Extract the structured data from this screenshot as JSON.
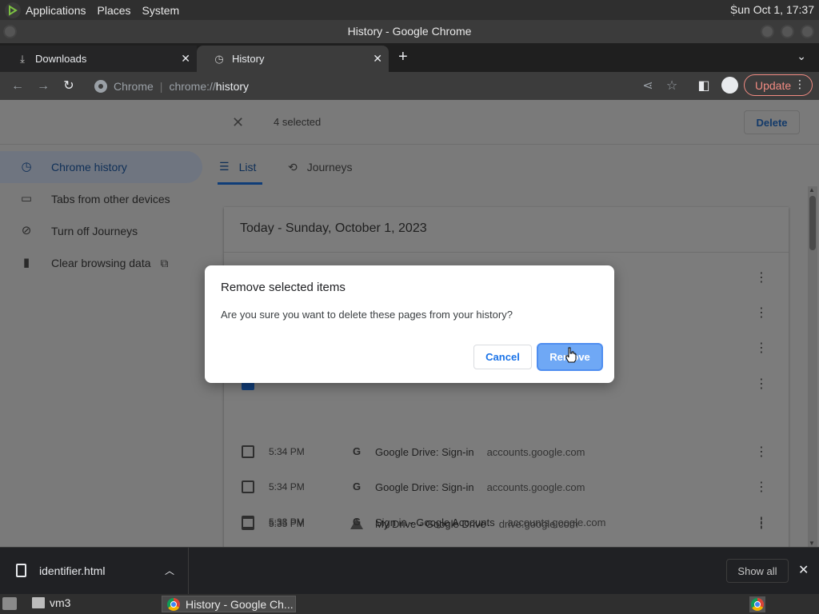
{
  "desktop": {
    "menu": [
      "Applications",
      "Places",
      "System"
    ],
    "clock": "Sun Oct  1, 17:37"
  },
  "window": {
    "title": "History - Google Chrome"
  },
  "tabs": [
    {
      "label": "Downloads",
      "icon": "download-icon"
    },
    {
      "label": "History",
      "icon": "history-clock-icon"
    }
  ],
  "toolbar": {
    "scheme": "Chrome",
    "url_host": "chrome://",
    "url_path": "history",
    "update_label": "Update"
  },
  "selection": {
    "count_label": "4 selected",
    "delete_label": "Delete"
  },
  "sidebar": {
    "items": [
      {
        "label": "Chrome history",
        "icon": "clock-icon"
      },
      {
        "label": "Tabs from other devices",
        "icon": "devices-icon"
      },
      {
        "label": "Turn off Journeys",
        "icon": "journeys-off-icon"
      },
      {
        "label": "Clear browsing data",
        "icon": "trash-icon"
      }
    ]
  },
  "view_tabs": [
    {
      "label": "List"
    },
    {
      "label": "Journeys"
    }
  ],
  "history": {
    "date_header": "Today - Sunday, October 1, 2023",
    "rows": [
      {
        "time": "5:35 PM",
        "title": "My Drive - Google Drive",
        "domain": "drive.google.com",
        "checked": false
      },
      {
        "time": "5:34 PM",
        "title": "Google Drive: Sign-in",
        "domain": "accounts.google.com",
        "checked": false
      },
      {
        "time": "5:34 PM",
        "title": "Google Drive: Sign-in",
        "domain": "accounts.google.com",
        "checked": false
      },
      {
        "time": "5:33 PM",
        "title": "Sign in - Google Accounts",
        "domain": "accounts.google.com",
        "checked": false
      }
    ]
  },
  "dialog": {
    "title": "Remove selected items",
    "message": "Are you sure you want to delete these pages from your history?",
    "cancel_label": "Cancel",
    "remove_label": "Remove"
  },
  "downloads": {
    "filename": "identifier.html",
    "show_all_label": "Show all"
  },
  "taskbar": {
    "workspace": "vm3",
    "window_label": "History - Google Ch..."
  },
  "colors": {
    "accent": "#1a73e8",
    "update": "#f28b82"
  }
}
